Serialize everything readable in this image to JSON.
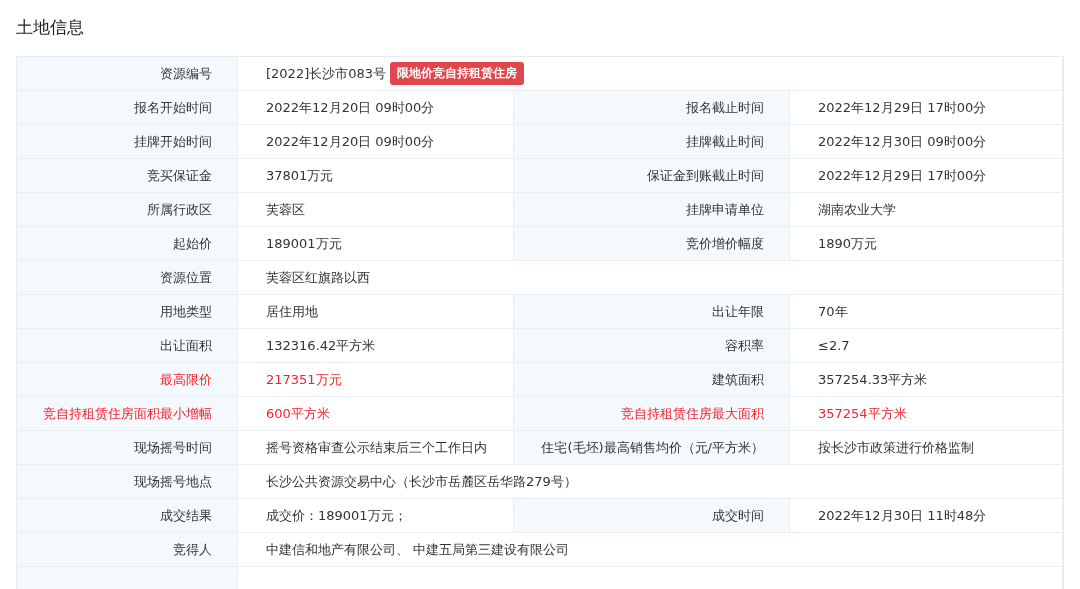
{
  "title": "土地信息",
  "rows": [
    {
      "cells": [
        {
          "label": "资源编号",
          "value": "[2022]长沙市083号",
          "badge": "限地价竞自持租赁住房",
          "highlight": false
        }
      ]
    },
    {
      "cells": [
        {
          "label": "报名开始时间",
          "value": "2022年12月20日 09时00分",
          "highlight": false
        },
        {
          "label": "报名截止时间",
          "value": "2022年12月29日 17时00分",
          "highlight": false
        }
      ]
    },
    {
      "cells": [
        {
          "label": "挂牌开始时间",
          "value": "2022年12月20日 09时00分",
          "highlight": false
        },
        {
          "label": "挂牌截止时间",
          "value": "2022年12月30日 09时00分",
          "highlight": false
        }
      ]
    },
    {
      "cells": [
        {
          "label": "竞买保证金",
          "value": "37801万元",
          "highlight": false
        },
        {
          "label": "保证金到账截止时间",
          "value": "2022年12月29日 17时00分",
          "highlight": false
        }
      ]
    },
    {
      "cells": [
        {
          "label": "所属行政区",
          "value": "芙蓉区",
          "highlight": false
        },
        {
          "label": "挂牌申请单位",
          "value": "湖南农业大学",
          "highlight": false
        }
      ]
    },
    {
      "cells": [
        {
          "label": "起始价",
          "value": "189001万元",
          "highlight": false
        },
        {
          "label": "竞价增价幅度",
          "value": "1890万元",
          "highlight": false
        }
      ]
    },
    {
      "cells": [
        {
          "label": "资源位置",
          "value": "芙蓉区红旗路以西",
          "highlight": false
        }
      ]
    },
    {
      "cells": [
        {
          "label": "用地类型",
          "value": "居住用地",
          "highlight": false
        },
        {
          "label": "出让年限",
          "value": "70年",
          "highlight": false
        }
      ]
    },
    {
      "cells": [
        {
          "label": "出让面积",
          "value": "132316.42平方米",
          "highlight": false
        },
        {
          "label": "容积率",
          "value": "≤2.7",
          "highlight": false
        }
      ]
    },
    {
      "cells": [
        {
          "label": "最高限价",
          "value": "217351万元",
          "highlight": true
        },
        {
          "label": "建筑面积",
          "value": "357254.33平方米",
          "highlight": false
        }
      ]
    },
    {
      "cells": [
        {
          "label": "竞自持租赁住房面积最小增幅",
          "value": "600平方米",
          "highlight": true
        },
        {
          "label": "竞自持租赁住房最大面积",
          "value": "357254平方米",
          "highlight": true
        }
      ]
    },
    {
      "cells": [
        {
          "label": "现场摇号时间",
          "value": "摇号资格审查公示结束后三个工作日内",
          "highlight": false
        },
        {
          "label": "住宅(毛坯)最高销售均价（元/平方米）",
          "value": "按长沙市政策进行价格监制",
          "highlight": false
        }
      ]
    },
    {
      "cells": [
        {
          "label": "现场摇号地点",
          "value": "长沙公共资源交易中心（长沙市岳麓区岳华路279号）",
          "highlight": false
        }
      ]
    },
    {
      "cells": [
        {
          "label": "成交结果",
          "value": "成交价：189001万元；",
          "highlight": false
        },
        {
          "label": "成交时间",
          "value": "2022年12月30日 11时48分",
          "highlight": false
        }
      ]
    },
    {
      "cells": [
        {
          "label": "竞得人",
          "value": "中建信和地产有限公司、 中建五局第三建设有限公司",
          "highlight": false
        }
      ]
    }
  ]
}
